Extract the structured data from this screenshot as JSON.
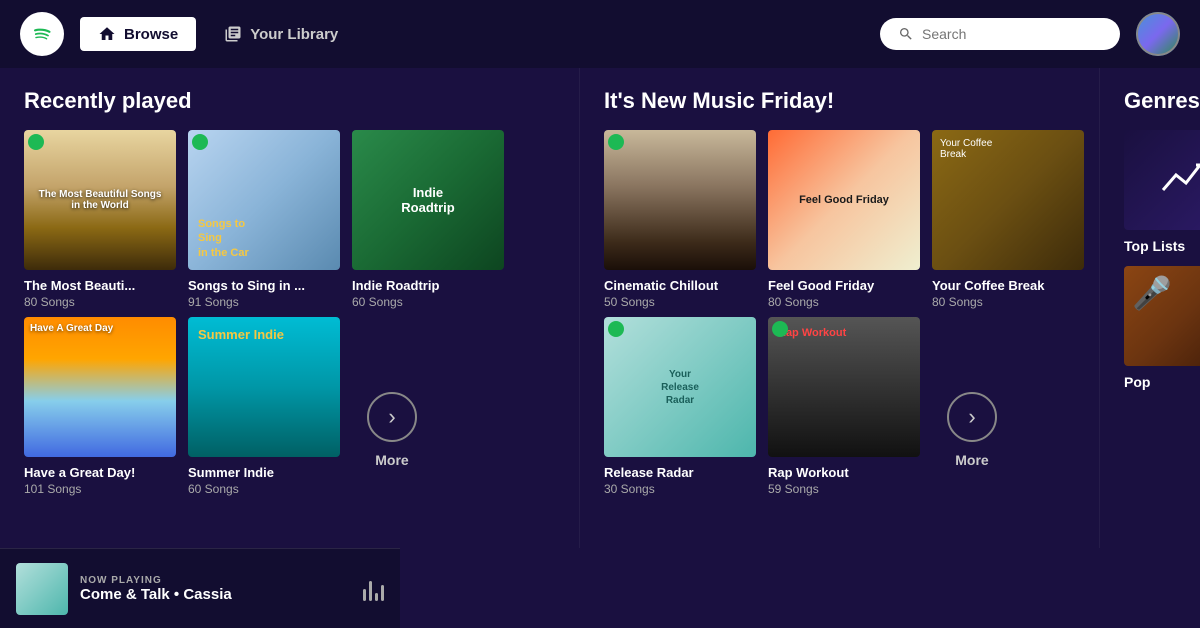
{
  "nav": {
    "browse_label": "Browse",
    "library_label": "Your Library",
    "search_placeholder": "Search"
  },
  "recently_played": {
    "title": "Recently played",
    "cards": [
      {
        "title": "The Most Beauti...",
        "sub": "80 Songs",
        "art": "beautiful"
      },
      {
        "title": "Songs to Sing in ...",
        "sub": "91 Songs",
        "art": "sing"
      },
      {
        "title": "Indie Roadtrip",
        "sub": "60 Songs",
        "art": "indie"
      },
      {
        "title": "Have a Great Day!",
        "sub": "101 Songs",
        "art": "greatday"
      },
      {
        "title": "Summer Indie",
        "sub": "60 Songs",
        "art": "summer"
      }
    ],
    "more_label": "More"
  },
  "new_music": {
    "title": "It's New Music Friday!",
    "cards": [
      {
        "title": "Cinematic Chillout",
        "sub": "50 Songs",
        "art": "cinematic"
      },
      {
        "title": "Feel Good Friday",
        "sub": "80 Songs",
        "art": "feelgood"
      },
      {
        "title": "Your Coffee Break",
        "sub": "80 Songs",
        "art": "coffee"
      },
      {
        "title": "Release Radar",
        "sub": "30 Songs",
        "art": "release"
      },
      {
        "title": "Rap Workout",
        "sub": "59 Songs",
        "art": "rap"
      }
    ],
    "more_label": "More"
  },
  "genres": {
    "title": "Genres & M",
    "cards": [
      {
        "title": "Top Lists",
        "art": "toplists"
      },
      {
        "title": "Pop",
        "art": "pop"
      }
    ]
  },
  "now_playing": {
    "label": "NOW PLAYING",
    "song": "Come & Talk • Cassia"
  }
}
